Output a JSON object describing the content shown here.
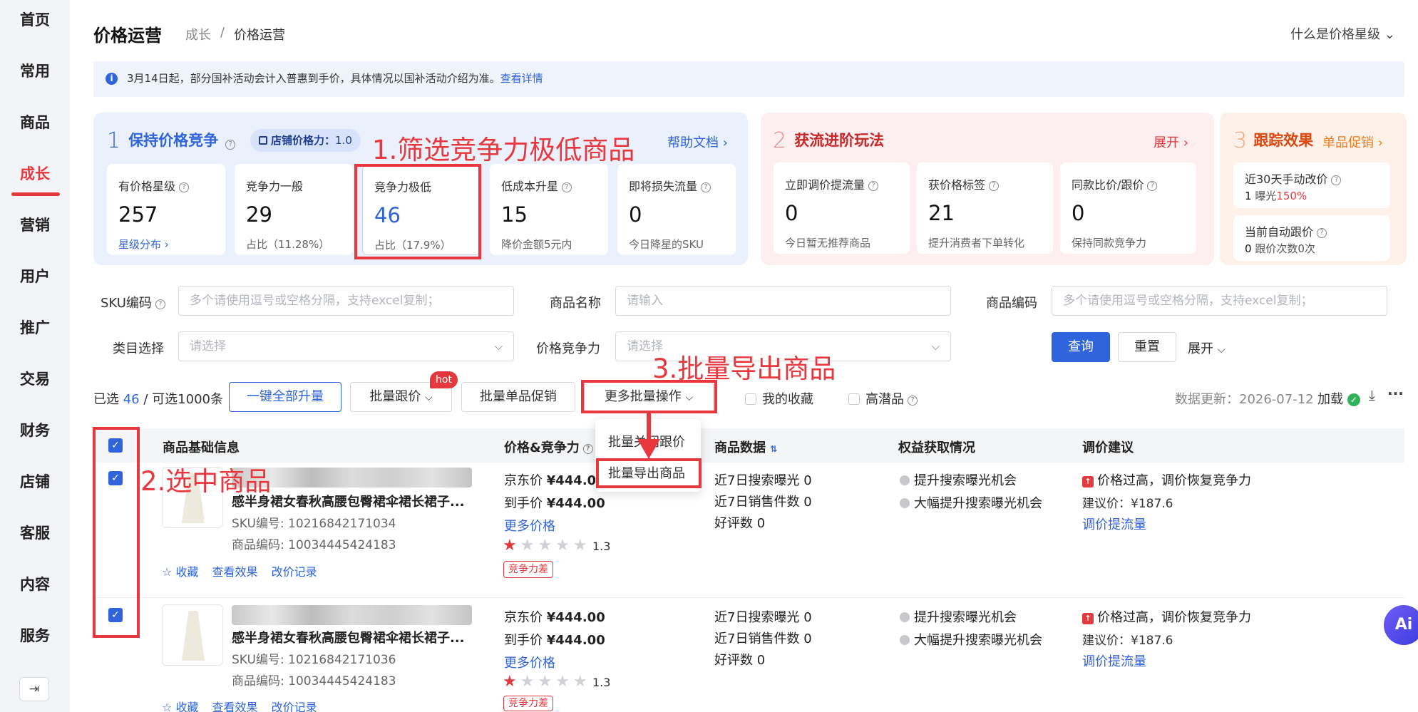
{
  "sidebar": {
    "items": [
      {
        "label": "首页"
      },
      {
        "label": "常用"
      },
      {
        "label": "商品"
      },
      {
        "label": "成长"
      },
      {
        "label": "营销"
      },
      {
        "label": "用户"
      },
      {
        "label": "推广"
      },
      {
        "label": "交易"
      },
      {
        "label": "财务"
      },
      {
        "label": "店铺"
      },
      {
        "label": "客服"
      },
      {
        "label": "内容"
      },
      {
        "label": "服务"
      }
    ],
    "active": "成长",
    "collapse_icon": "collapse-sidebar-icon"
  },
  "header": {
    "title": "价格运营",
    "breadcrumb": [
      "成长",
      "/",
      "价格运营"
    ],
    "help_link": "什么是价格星级"
  },
  "notice": {
    "text": "3月14日起，部分国补活动会计入普惠到手价，具体情况以国补活动介绍为准。",
    "link": "查看详情"
  },
  "section1": {
    "number": "1",
    "title": "保持价格竞争",
    "badge_label": "店铺价格力：",
    "badge_value": "1.0",
    "help_doc": "帮助文档",
    "cards": [
      {
        "label": "有价格星级",
        "value": "257",
        "sub": "星级分布"
      },
      {
        "label": "竞争力一般",
        "value": "29",
        "sub": "占比（11.28%）"
      },
      {
        "label": "竞争力极低",
        "value": "46",
        "sub": "占比（17.9%）"
      },
      {
        "label": "低成本升星",
        "value": "15",
        "sub": "降价金额5元内"
      },
      {
        "label": "即将损失流量",
        "value": "0",
        "sub": "今日降星的SKU"
      }
    ]
  },
  "section2": {
    "number": "2",
    "title": "获流进阶玩法",
    "expand": "展开",
    "cards": [
      {
        "label": "立即调价提流量",
        "value": "0",
        "sub": "今日暂无推荐商品"
      },
      {
        "label": "获价格标签",
        "value": "21",
        "sub": "提升消费者下单转化"
      },
      {
        "label": "同款比价/跟价",
        "value": "0",
        "sub": "保持同款竞争力"
      }
    ]
  },
  "section3": {
    "number": "3",
    "title": "跟踪效果",
    "link": "单品促销",
    "cards": [
      {
        "label": "近30天手动改价",
        "value": "1",
        "sub_prefix": "曝光",
        "sub_highlight": "150%"
      },
      {
        "label": "当前自动跟价",
        "value": "0",
        "sub_prefix": "跟价次数0次",
        "sub_highlight": ""
      }
    ]
  },
  "filters": {
    "sku_label": "SKU编码",
    "sku_placeholder": "多个请使用逗号或空格分隔，支持excel复制；",
    "name_label": "商品名称",
    "name_placeholder": "请输入",
    "code_label": "商品编码",
    "code_placeholder": "多个请使用逗号或空格分隔，支持excel复制；",
    "category_label": "类目选择",
    "category_placeholder": "请选择",
    "competition_label": "价格竞争力",
    "competition_placeholder": "请选择",
    "query": "查询",
    "reset": "重置",
    "expand": "展开"
  },
  "toolbar": {
    "selected_prefix": "已选",
    "selected_count": "46",
    "selected_suffix": "/ 可选1000条",
    "upgrade_all": "一键全部升量",
    "batch_follow": "批量跟价",
    "hot_badge": "hot",
    "batch_promo": "批量单品促销",
    "more_batch": "更多批量操作",
    "my_favorites": "我的收藏",
    "high_potential": "高潜品",
    "data_update": "数据更新：2026-07-12",
    "load": "加载"
  },
  "dropdown": {
    "items": [
      "批量关闭跟价",
      "批量导出商品"
    ]
  },
  "table": {
    "headers": [
      "商品基础信息",
      "价格&竞争力",
      "商品数据",
      "权益获取情况",
      "调价建议"
    ],
    "rows": [
      {
        "title": "感半身裙女春秋高腰包臀裙伞裙长裙子...",
        "sku": "SKU编号: 10216842171034",
        "code": "商品编码: 10034445424183",
        "actions": [
          "收藏",
          "查看效果",
          "改价记录"
        ],
        "jd_price_label": "京东价",
        "jd_price": "¥444.00",
        "hand_price_label": "到手价",
        "hand_price": "¥444.00",
        "more_price": "更多价格",
        "rating": "1.3",
        "tag": "竞争力差",
        "search_exposure": "近7日搜索曝光",
        "search_exposure_val": "0",
        "sales": "近7日销售件数",
        "sales_val": "0",
        "reviews": "好评数",
        "reviews_val": "0",
        "right1": "提升搜索曝光机会",
        "right2": "大幅提升搜索曝光机会",
        "suggest": "价格过高，调价恢复竞争力",
        "suggest_price": "建议价：¥187.6",
        "suggest_link": "调价提流量"
      },
      {
        "title": "感半身裙女春秋高腰包臀裙伞裙长裙子...",
        "sku": "SKU编号: 10216842171036",
        "code": "商品编码: 10034445424183",
        "actions": [
          "收藏",
          "查看效果",
          "改价记录"
        ],
        "jd_price_label": "京东价",
        "jd_price": "¥444.00",
        "hand_price_label": "到手价",
        "hand_price": "¥444.00",
        "more_price": "更多价格",
        "rating": "1.3",
        "tag": "竞争力差",
        "search_exposure": "近7日搜索曝光",
        "search_exposure_val": "0",
        "sales": "近7日销售件数",
        "sales_val": "0",
        "reviews": "好评数",
        "reviews_val": "0",
        "right1": "提升搜索曝光机会",
        "right2": "大幅提升搜索曝光机会",
        "suggest": "价格过高，调价恢复竞争力",
        "suggest_price": "建议价：¥187.6",
        "suggest_link": "调价提流量"
      }
    ]
  },
  "annotations": {
    "step1": "1.筛选竞争力极低商品",
    "step2": "2.选中商品",
    "step3": "3.批量导出商品"
  },
  "ai_button": "Ai",
  "colors": {
    "brand_red": "#e4393c",
    "primary_blue": "#2f64dc",
    "annotation_red": "#e8383d"
  }
}
